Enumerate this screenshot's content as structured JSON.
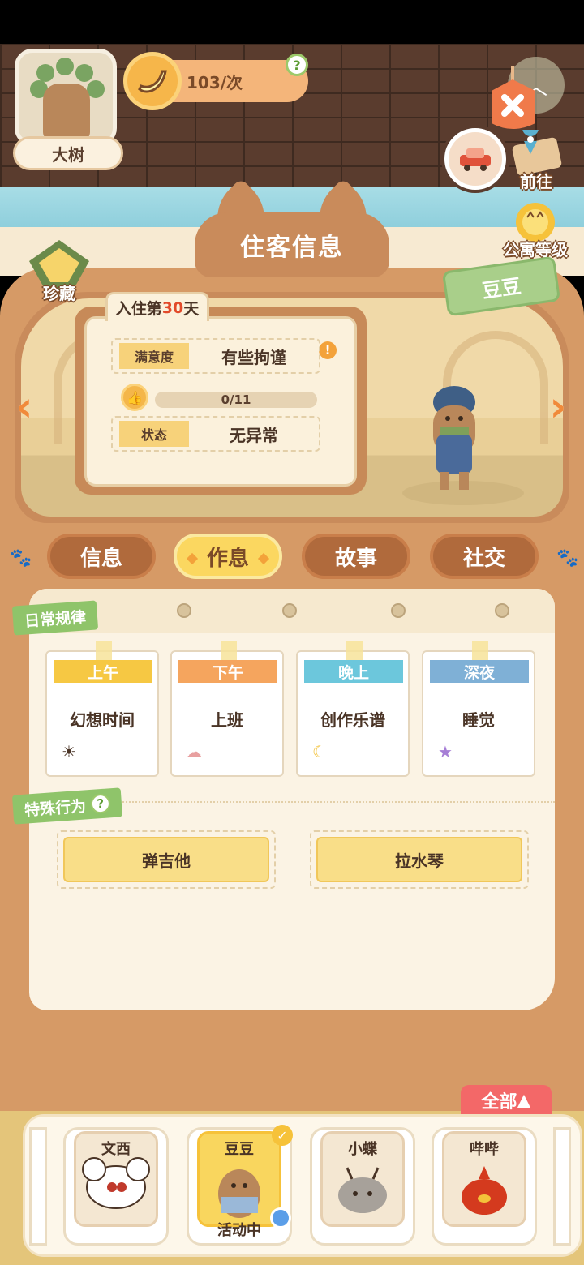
{
  "header": {
    "tree_label": "大树",
    "banana_rate": "103/次",
    "help_icon": "?",
    "go_label": "前往",
    "level_label": "公寓等级",
    "treasure_label": "珍藏"
  },
  "panel": {
    "title": "住客信息",
    "resident_name": "豆豆",
    "stay_prefix": "入住第",
    "stay_days": "30",
    "stay_suffix": "天",
    "satisfaction_label": "满意度",
    "satisfaction_value": "有些拘谨",
    "progress_text": "0/11",
    "status_label": "状态",
    "status_value": "无异常"
  },
  "tabs": [
    {
      "label": "信息"
    },
    {
      "label": "作息"
    },
    {
      "label": "故事"
    },
    {
      "label": "社交"
    }
  ],
  "routine": {
    "title": "日常规律",
    "slots": [
      {
        "period": "上午",
        "activity": "幻想时间",
        "color": "#f6c843",
        "icon": "sun-icon"
      },
      {
        "period": "下午",
        "activity": "上班",
        "color": "#f5a55e",
        "icon": "cloud-icon"
      },
      {
        "period": "晚上",
        "activity": "创作乐谱",
        "color": "#6cc7dc",
        "icon": "moon-icon"
      },
      {
        "period": "深夜",
        "activity": "睡觉",
        "color": "#7fb0d6",
        "icon": "star-icon"
      }
    ]
  },
  "special": {
    "title": "特殊行为",
    "help": "?",
    "items": [
      "弹吉他",
      "拉水琴"
    ]
  },
  "roster": {
    "filter_label": "全部",
    "residents": [
      {
        "name": "文西",
        "status": ""
      },
      {
        "name": "豆豆",
        "status": "活动中"
      },
      {
        "name": "小蝶",
        "status": ""
      },
      {
        "name": "哔哔",
        "status": ""
      }
    ]
  }
}
